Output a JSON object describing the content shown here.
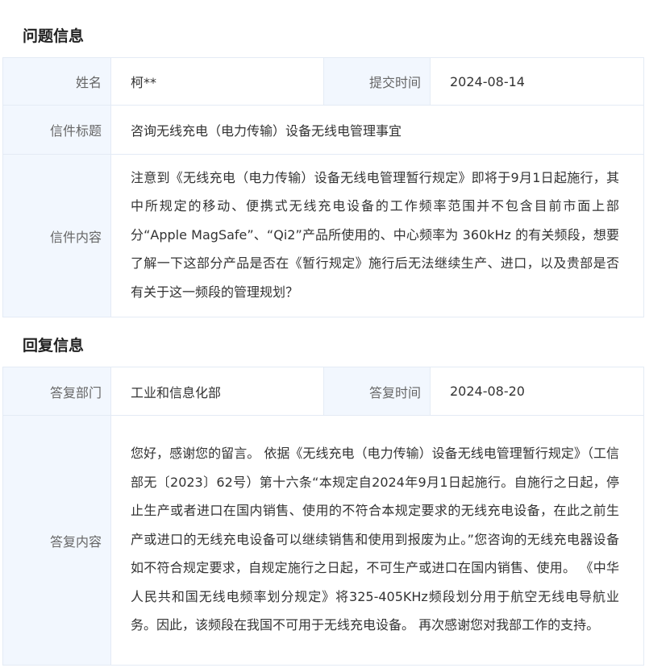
{
  "question": {
    "section_title": "问题信息",
    "name_label": "姓名",
    "name_value": "柯**",
    "submit_time_label": "提交时间",
    "submit_time_value": "2024-08-14",
    "subject_label": "信件标题",
    "subject_value": "咨询无线充电（电力传输）设备无线电管理事宜",
    "content_label": "信件内容",
    "content_value": "注意到《无线充电（电力传输）设备无线电管理暂行规定》即将于9月1日起施行，其中所规定的移动、便携式无线充电设备的工作频率范围并不包含目前市面上部分“Apple MagSafe”、“Qi2”产品所使用的、中心频率为 360kHz 的有关频段，想要了解一下这部分产品是否在《暂行规定》施行后无法继续生产、进口，以及贵部是否有关于这一频段的管理规划？"
  },
  "reply": {
    "section_title": "回复信息",
    "dept_label": "答复部门",
    "dept_value": "工业和信息化部",
    "reply_time_label": "答复时间",
    "reply_time_value": "2024-08-20",
    "content_label": "答复内容",
    "content_value": "您好，感谢您的留言。 依据《无线充电（电力传输）设备无线电管理暂行规定》（工信部无〔2023〕62号）第十六条“本规定自2024年9月1日起施行。自施行之日起，停止生产或者进口在国内销售、使用的不符合本规定要求的无线充电设备，在此之前生产或进口的无线充电设备可以继续销售和使用到报废为止。”您咨询的无线充电器设备如不符合规定要求，自规定施行之日起，不可生产或进口在国内销售、使用。 《中华人民共和国无线电频率划分规定》将325-405KHz频段划分用于航空无线电导航业务。因此，该频段在我国不可用于无线充电设备。 再次感谢您对我部工作的支持。"
  }
}
